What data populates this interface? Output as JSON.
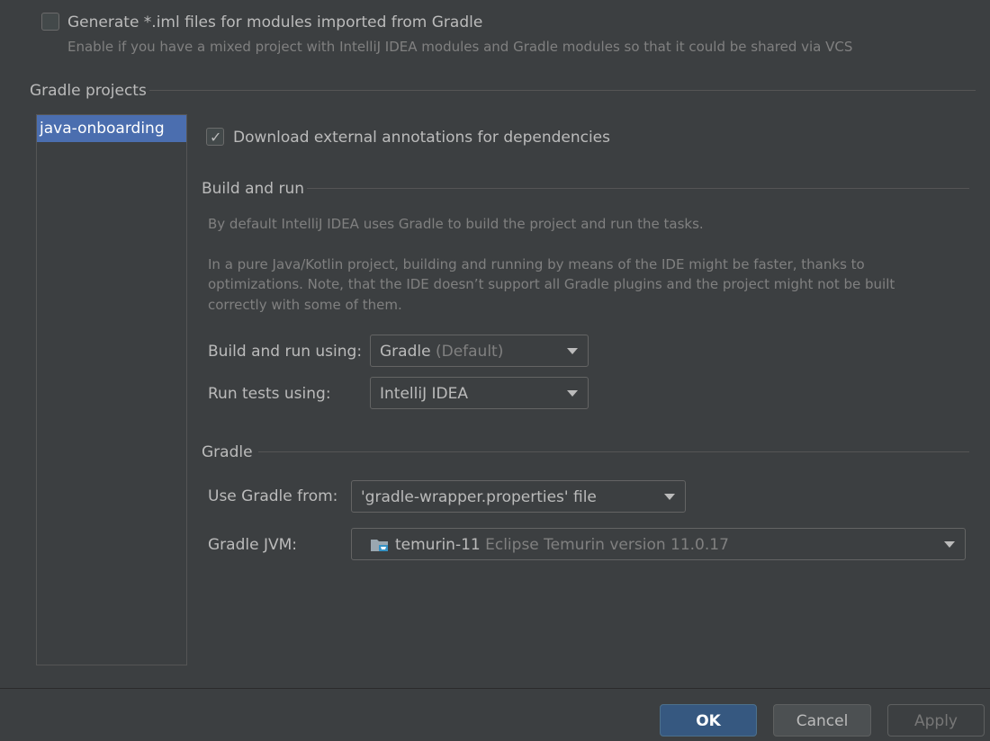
{
  "top": {
    "iml_checkbox_label": "Generate *.iml files for modules imported from Gradle",
    "iml_checkbox_checked": false,
    "iml_hint": "Enable if you have a mixed project with IntelliJ IDEA modules and Gradle modules so that it could be shared via VCS"
  },
  "gradle_projects": {
    "title": "Gradle projects",
    "items": [
      "java-onboarding"
    ],
    "selected": "java-onboarding"
  },
  "settings": {
    "annotations_label": "Download external annotations for dependencies",
    "annotations_checked": true,
    "build_and_run": {
      "title": "Build and run",
      "description_1": "By default IntelliJ IDEA uses Gradle to build the project and run the tasks.",
      "description_2_line1": "In a pure Java/Kotlin project, building and running by means of the IDE might be faster, thanks to",
      "description_2_line2": "optimizations. Note, that the IDE doesn’t support all Gradle plugins and the project might not be built",
      "description_2_line3": "correctly with some of them.",
      "build_using_label": "Build and run using:",
      "build_using_value": "Gradle",
      "build_using_suffix": "(Default)",
      "tests_using_label": "Run tests using:",
      "tests_using_value": "IntelliJ IDEA"
    },
    "gradle": {
      "title": "Gradle",
      "use_from_label": "Use Gradle from:",
      "use_from_value": "'gradle-wrapper.properties' file",
      "jvm_label": "Gradle JVM:",
      "jvm_name": "temurin-11",
      "jvm_detail": "Eclipse Temurin version 11.0.17",
      "jvm_icon": "jdk-folder-icon"
    }
  },
  "footer": {
    "ok_label": "OK",
    "cancel_label": "Cancel",
    "apply_label": "Apply"
  }
}
